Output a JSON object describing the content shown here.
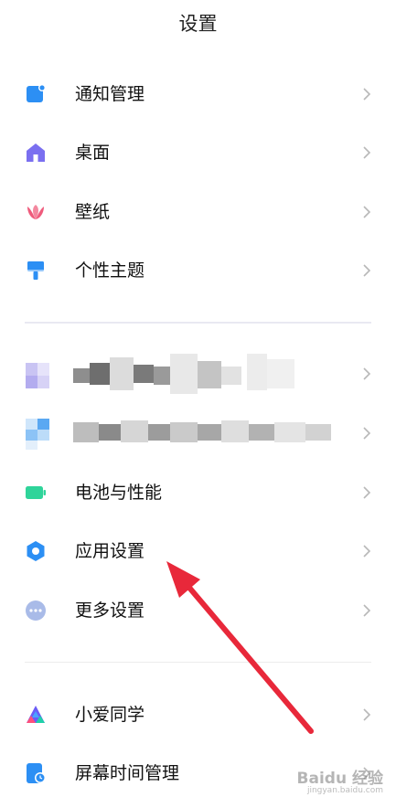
{
  "header": {
    "title": "设置"
  },
  "groups": [
    {
      "items": [
        {
          "label": "通知管理",
          "icon": "notification-icon",
          "color": "#2c8ff4"
        },
        {
          "label": "桌面",
          "icon": "home-icon",
          "color": "#7a6ff0"
        },
        {
          "label": "壁纸",
          "icon": "flower-icon",
          "color": "#ef5b7c"
        },
        {
          "label": "个性主题",
          "icon": "paintbrush-icon",
          "color": "#2c8ff4"
        }
      ]
    },
    {
      "items": [
        {
          "label": "",
          "icon": "blurred-icon",
          "color": "#9a8fe8"
        },
        {
          "label": "",
          "icon": "blurred-icon",
          "color": "#2c9ef4"
        },
        {
          "label": "电池与性能",
          "icon": "battery-icon",
          "color": "#2fd49a"
        },
        {
          "label": "应用设置",
          "icon": "gear-icon",
          "color": "#2c8ff4"
        },
        {
          "label": "更多设置",
          "icon": "more-icon",
          "color": "#a0b4e6"
        }
      ]
    },
    {
      "items": [
        {
          "label": "小爱同学",
          "icon": "xiaoai-icon",
          "color": "#6b5cf6"
        },
        {
          "label": "屏幕时间管理",
          "icon": "screen-time-icon",
          "color": "#2c8ff4"
        }
      ]
    }
  ],
  "annotation": {
    "arrow_color": "#e8283a"
  },
  "watermark": {
    "text": "Baidu 经验",
    "sub": "jingyan.baidu.com"
  }
}
